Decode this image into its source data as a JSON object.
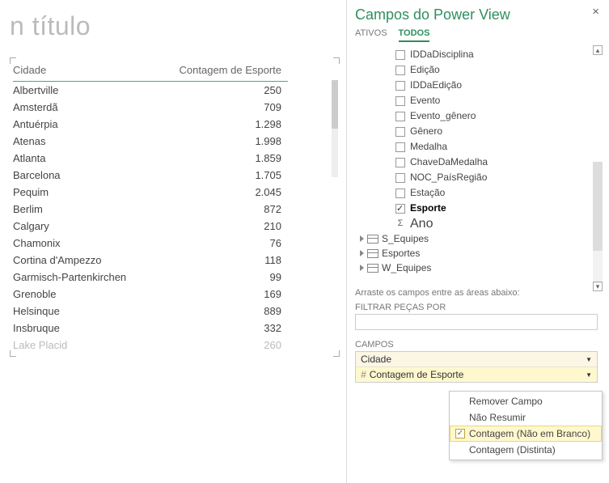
{
  "left": {
    "title": "n título",
    "columns": {
      "city": "Cidade",
      "count": "Contagem de Esporte"
    },
    "rows": [
      {
        "city": "Albertville",
        "count": "250"
      },
      {
        "city": "Amsterdã",
        "count": "709"
      },
      {
        "city": "Antuérpia",
        "count": "1.298"
      },
      {
        "city": "Atenas",
        "count": "1.998"
      },
      {
        "city": "Atlanta",
        "count": "1.859"
      },
      {
        "city": "Barcelona",
        "count": "1.705"
      },
      {
        "city": "Pequim",
        "count": "2.045"
      },
      {
        "city": "Berlim",
        "count": "872"
      },
      {
        "city": "Calgary",
        "count": "210"
      },
      {
        "city": "Chamonix",
        "count": "76"
      },
      {
        "city": "Cortina d'Ampezzo",
        "count": "118"
      },
      {
        "city": "Garmisch-Partenkirchen",
        "count": "99"
      },
      {
        "city": "Grenoble",
        "count": "169"
      },
      {
        "city": "Helsinque",
        "count": "889"
      },
      {
        "city": "Insbruque",
        "count": "332"
      },
      {
        "city": "Lake Placid",
        "count": "260"
      }
    ]
  },
  "right": {
    "panel_title": "Campos do Power View",
    "close": "×",
    "tabs": {
      "active": "ATIVOS",
      "all": "TODOS"
    },
    "fields": [
      {
        "label": "IDDaDisciplina",
        "checked": false
      },
      {
        "label": "Edição",
        "checked": false
      },
      {
        "label": "IDDaEdição",
        "checked": false
      },
      {
        "label": "Evento",
        "checked": false
      },
      {
        "label": "Evento_gênero",
        "checked": false
      },
      {
        "label": "Gênero",
        "checked": false
      },
      {
        "label": "Medalha",
        "checked": false
      },
      {
        "label": "ChaveDaMedalha",
        "checked": false
      },
      {
        "label": "NOC_PaísRegião",
        "checked": false
      },
      {
        "label": "Estação",
        "checked": false
      },
      {
        "label": "Esporte",
        "checked": true,
        "bold": true
      }
    ],
    "ano_label": "Ano",
    "tables": [
      {
        "label": "S_Equipes"
      },
      {
        "label": "Esportes"
      },
      {
        "label": "W_Equipes"
      }
    ],
    "drag_hint": "Arraste os campos entre as áreas abaixo:",
    "filter_label": "FILTRAR PEÇAS POR",
    "fields_label": "CAMPOS",
    "drop": {
      "row1": "Cidade",
      "row2": "Contagem de Esporte",
      "hash": "#"
    },
    "menu": {
      "remove": "Remover Campo",
      "nosum": "Não Resumir",
      "count_nb": "Contagem (Não em Branco)",
      "count_d": "Contagem (Distinta)"
    }
  }
}
